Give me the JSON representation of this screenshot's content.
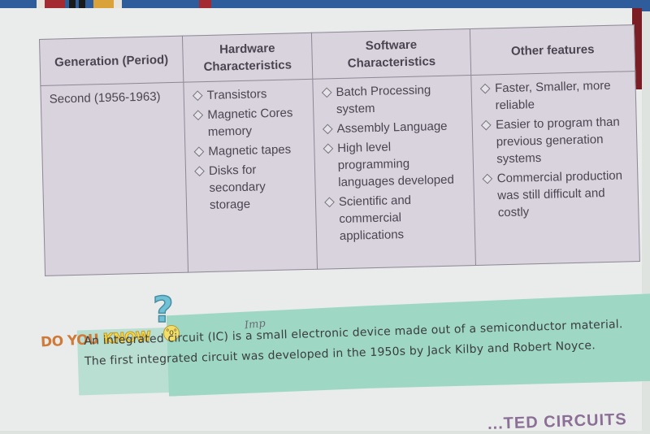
{
  "table": {
    "headers": [
      "Generation (Period)",
      "Hardware Characteristics",
      "Software Characteristics",
      "Other features"
    ],
    "rows": [
      {
        "generation": "Second (1956-1963)",
        "hardware": [
          "Transistors",
          "Magnetic Cores memory",
          "Magnetic tapes",
          "Disks for secondary storage"
        ],
        "software": [
          "Batch Processing system",
          "Assembly Language",
          "High level programming languages developed",
          "Scientific and commercial applications"
        ],
        "other": [
          "Faster, Smaller, more reliable",
          "Easier to program than previous generation systems",
          "Commercial production was still difficult and costly"
        ]
      }
    ]
  },
  "do_you_know": {
    "title_part1": "DO YOU",
    "title_part2": "KNOW",
    "question_mark": "?",
    "handwritten_note": "Imp",
    "text": "An integrated circuit (IC) is a small electronic device made out of a semiconductor material. The first integrated circuit was developed in the 1950s by Jack Kilby and Robert Noyce."
  },
  "next_heading_partial": "...TED CIRCUITS",
  "colors": {
    "table_bg": "#d8d3dd",
    "callout_band": "#9ed8c4",
    "title_orange": "#d07a3a",
    "title_yellow": "#f2dc4a",
    "heading_purple": "#8c6f96"
  }
}
